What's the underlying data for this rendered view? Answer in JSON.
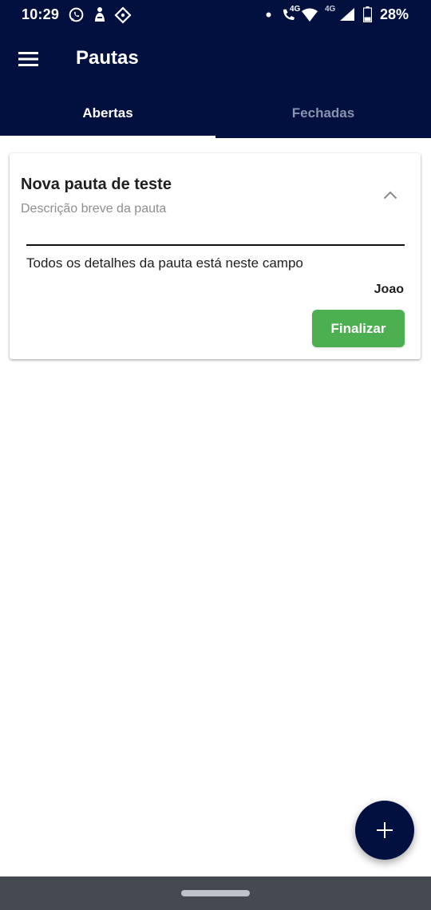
{
  "status_bar": {
    "time": "10:29",
    "battery_percent": "28%",
    "network_type_1": "4G",
    "network_type_2": "4G",
    "icons": [
      "whatsapp-icon",
      "notification-icon",
      "location-icon",
      "dot-icon",
      "wifi-call-icon",
      "wifi-icon",
      "signal-icon",
      "battery-icon"
    ]
  },
  "app_bar": {
    "title": "Pautas",
    "menu_icon": "menu-icon"
  },
  "tabs": [
    {
      "label": "Abertas",
      "selected": true
    },
    {
      "label": "Fechadas",
      "selected": false
    }
  ],
  "card": {
    "title": "Nova pauta de teste",
    "subtitle": "Descrição breve da pauta",
    "details": "Todos os detalhes da pauta está neste campo",
    "author": "Joao",
    "finalize_label": "Finalizar",
    "expanded": true
  },
  "fab": {
    "icon": "plus-icon"
  },
  "colors": {
    "primary": "#02103f",
    "accent_green": "#4caf50",
    "tab_inactive": "#8a93ad",
    "nav_bar": "#444a50"
  }
}
